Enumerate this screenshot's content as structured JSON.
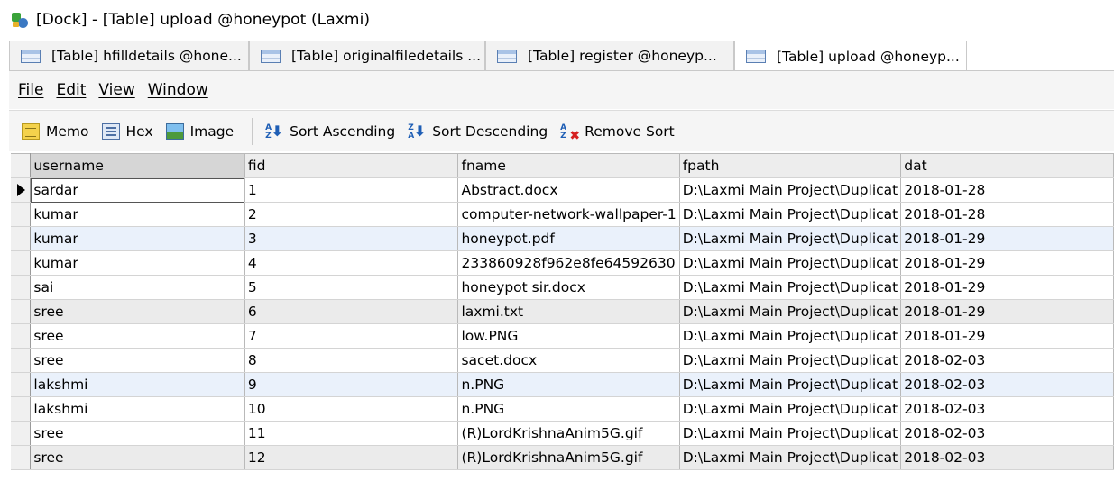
{
  "window": {
    "title": "[Dock] - [Table] upload @honeypot (Laxmi)"
  },
  "tabs": [
    {
      "label": "[Table] hfilldetails @hone...",
      "active": false
    },
    {
      "label": "[Table] originalfiledetails ...",
      "active": false
    },
    {
      "label": "[Table] register @honeyp...",
      "active": false
    },
    {
      "label": "[Table] upload @honeyp...",
      "active": true
    }
  ],
  "menu": [
    "File",
    "Edit",
    "View",
    "Window"
  ],
  "toolbar": {
    "memo": "Memo",
    "hex": "Hex",
    "image": "Image",
    "sort_asc": "Sort Ascending",
    "sort_desc": "Sort Descending",
    "remove_sort": "Remove Sort"
  },
  "table": {
    "columns": [
      "username",
      "fid",
      "fname",
      "fpath",
      "dat"
    ],
    "rows": [
      [
        "sardar",
        "1",
        "Abstract.docx",
        "D:\\Laxmi Main Project\\Duplicat",
        "2018-01-28"
      ],
      [
        "kumar",
        "2",
        "computer-network-wallpaper-1",
        "D:\\Laxmi Main Project\\Duplicat",
        "2018-01-28"
      ],
      [
        "kumar",
        "3",
        "honeypot.pdf",
        "D:\\Laxmi Main Project\\Duplicat",
        "2018-01-29"
      ],
      [
        "kumar",
        "4",
        "233860928f962e8fe64592630",
        "D:\\Laxmi Main Project\\Duplicat",
        "2018-01-29"
      ],
      [
        "sai",
        "5",
        "honeypot sir.docx",
        "D:\\Laxmi Main Project\\Duplicat",
        "2018-01-29"
      ],
      [
        "sree",
        "6",
        "laxmi.txt",
        "D:\\Laxmi Main Project\\Duplicat",
        "2018-01-29"
      ],
      [
        "sree",
        "7",
        "low.PNG",
        "D:\\Laxmi Main Project\\Duplicat",
        "2018-01-29"
      ],
      [
        "sree",
        "8",
        "sacet.docx",
        "D:\\Laxmi Main Project\\Duplicat",
        "2018-02-03"
      ],
      [
        "lakshmi",
        "9",
        "n.PNG",
        "D:\\Laxmi Main Project\\Duplicat",
        "2018-02-03"
      ],
      [
        "lakshmi",
        "10",
        "n.PNG",
        "D:\\Laxmi Main Project\\Duplicat",
        "2018-02-03"
      ],
      [
        "sree",
        "11",
        "(R)LordKrishnaAnim5G.gif",
        "D:\\Laxmi Main Project\\Duplicat",
        "2018-02-03"
      ],
      [
        "sree",
        "12",
        "(R)LordKrishnaAnim5G.gif",
        "D:\\Laxmi Main Project\\Duplicat",
        "2018-02-03"
      ]
    ]
  }
}
